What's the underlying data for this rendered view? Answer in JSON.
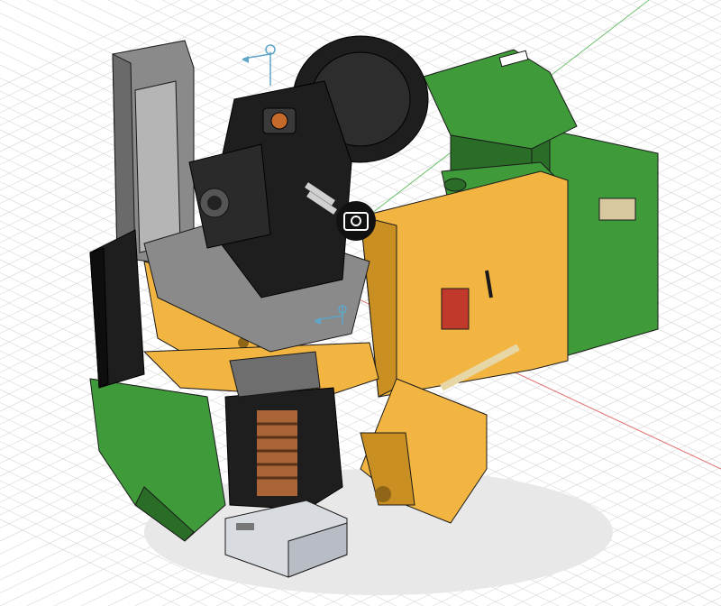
{
  "viewport": {
    "background": "#ffffff",
    "grid_color": "#d6d6d6",
    "axis_x_color": "#e07070",
    "axis_y_color": "#70c070"
  },
  "model": {
    "colors": {
      "yellow": "#f2b541",
      "yellow_dark": "#c98f22",
      "green": "#3f9a3a",
      "green_dark": "#2a6d27",
      "black": "#1e1e1e",
      "grey": "#8a8a8a",
      "silver": "#d8dbe0",
      "copper": "#b86b3a",
      "red": "#c0392b"
    }
  },
  "icons": {
    "camera": "camera-icon",
    "gizmo_top": "move-gizmo-icon",
    "gizmo_mid": "move-gizmo-icon"
  }
}
